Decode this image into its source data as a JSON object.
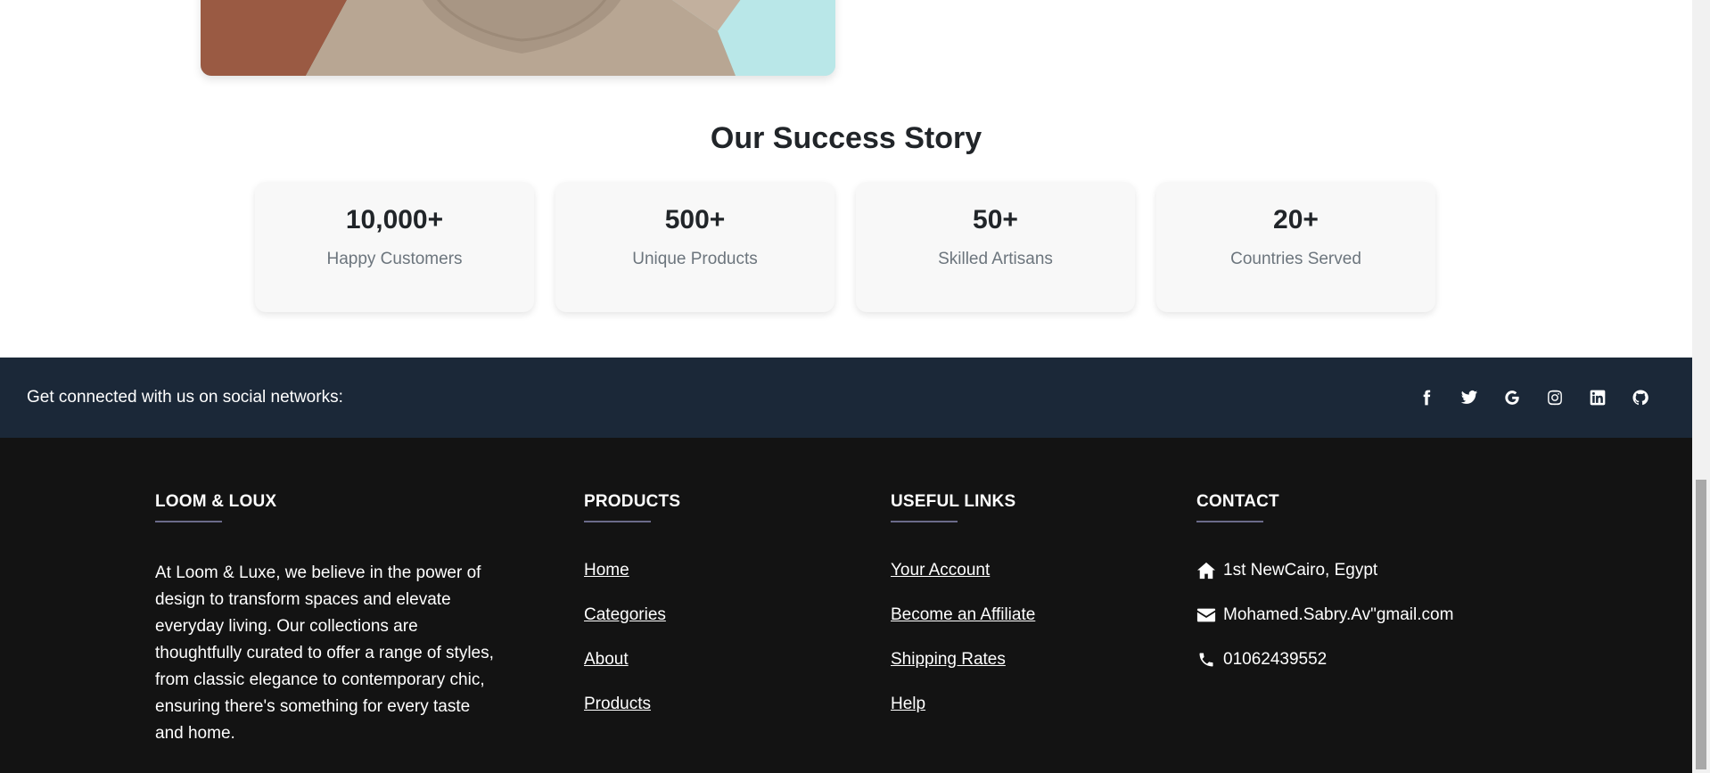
{
  "success": {
    "title": "Our Success Story",
    "stats": [
      {
        "value": "10,000+",
        "label": "Happy Customers"
      },
      {
        "value": "500+",
        "label": "Unique Products"
      },
      {
        "value": "50+",
        "label": "Skilled Artisans"
      },
      {
        "value": "20+",
        "label": "Countries Served"
      }
    ]
  },
  "social": {
    "text": "Get connected with us on social networks:",
    "icons": [
      "facebook-icon",
      "twitter-icon",
      "google-icon",
      "instagram-icon",
      "linkedin-icon",
      "github-icon"
    ]
  },
  "footer": {
    "brand": {
      "title": "LOOM & LOUX",
      "description": "At Loom & Luxe, we believe in the power of design to transform spaces and elevate everyday living. Our collections are thoughtfully curated to offer a range of styles, from classic elegance to contemporary chic, ensuring there's something for every taste and home."
    },
    "products": {
      "title": "PRODUCTS",
      "links": [
        "Home",
        "Categories",
        "About",
        "Products"
      ]
    },
    "useful_links": {
      "title": "USEFUL LINKS",
      "links": [
        "Your Account",
        "Become an Affiliate",
        "Shipping Rates",
        "Help"
      ]
    },
    "contact": {
      "title": "CONTACT",
      "address": "1st NewCairo, Egypt",
      "email": "Mohamed.Sabry.Av\"gmail.com",
      "phone": "01062439552"
    }
  },
  "colors": {
    "social_bar": "#1b2838",
    "footer_bg": "#131313",
    "card_bg": "#f8f8f8"
  }
}
